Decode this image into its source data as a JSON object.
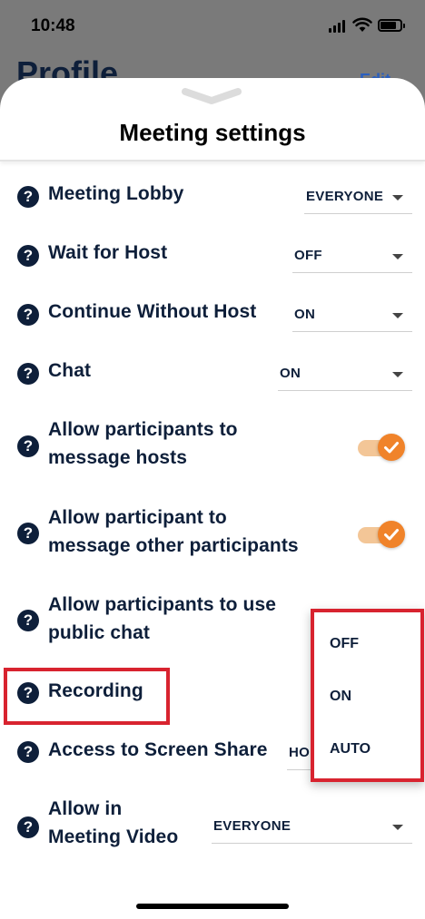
{
  "status_bar": {
    "time": "10:48"
  },
  "background": {
    "title": "Profile",
    "action": "Edit"
  },
  "sheet": {
    "title": "Meeting settings",
    "settings": [
      {
        "label": "Meeting Lobby",
        "control": "select",
        "value": "EVERYONE"
      },
      {
        "label": "Wait for Host",
        "control": "select",
        "value": "OFF"
      },
      {
        "label": "Continue Without Host",
        "control": "select",
        "value": "ON"
      },
      {
        "label": "Chat",
        "control": "select",
        "value": "ON"
      },
      {
        "label_lines": [
          "Allow participants to",
          "message hosts"
        ],
        "control": "toggle",
        "checked": true
      },
      {
        "label_lines": [
          "Allow participant to",
          "message other participants"
        ],
        "control": "toggle",
        "checked": true
      },
      {
        "label_lines": [
          "Allow participants to use",
          "public chat"
        ],
        "control": "toggle"
      },
      {
        "label": "Recording",
        "control": "select"
      },
      {
        "label": "Access to Screen Share",
        "control": "select",
        "value": "HO"
      },
      {
        "label_lines": [
          "Allow in",
          "Meeting Video"
        ],
        "control": "select",
        "value": "EVERYONE"
      }
    ]
  },
  "dropdown": {
    "options": [
      "OFF",
      "ON",
      "AUTO"
    ]
  },
  "colors": {
    "navy": "#0e1f3a",
    "accent": "#f0832a",
    "highlight": "#d8232f"
  },
  "icons": {
    "help": "question-circle-icon",
    "caret": "caret-down-icon",
    "check": "check-icon"
  }
}
